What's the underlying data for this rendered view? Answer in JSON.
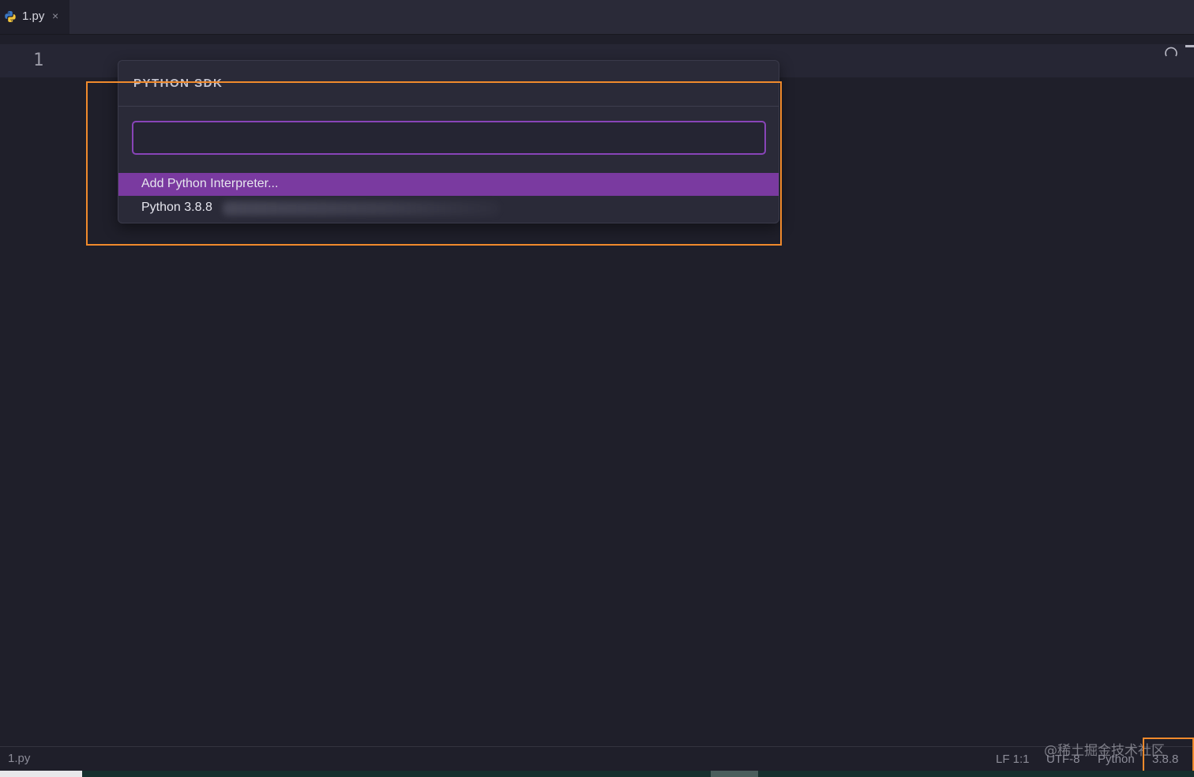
{
  "tab": {
    "label": "1.py",
    "close_glyph": "×",
    "icon": "python-icon"
  },
  "editor": {
    "line_number": "1"
  },
  "popup": {
    "title": "PYTHON SDK",
    "input_value": "",
    "items": [
      {
        "label": "Add Python Interpreter...",
        "selected": true
      },
      {
        "label": "Python 3.8.8",
        "selected": false
      }
    ]
  },
  "statusbar": {
    "file": "1.py",
    "eol_position": "LF 1:1",
    "encoding": "UTF-8",
    "language": "Python",
    "interpreter_version": "3.8.8",
    "watermark": "@稀土掘金技术社区"
  },
  "colors": {
    "selection_accent": "#7a3aa0",
    "input_border": "#8844b8",
    "annotation": "#f08a2c",
    "background": "#1f1f2a"
  }
}
